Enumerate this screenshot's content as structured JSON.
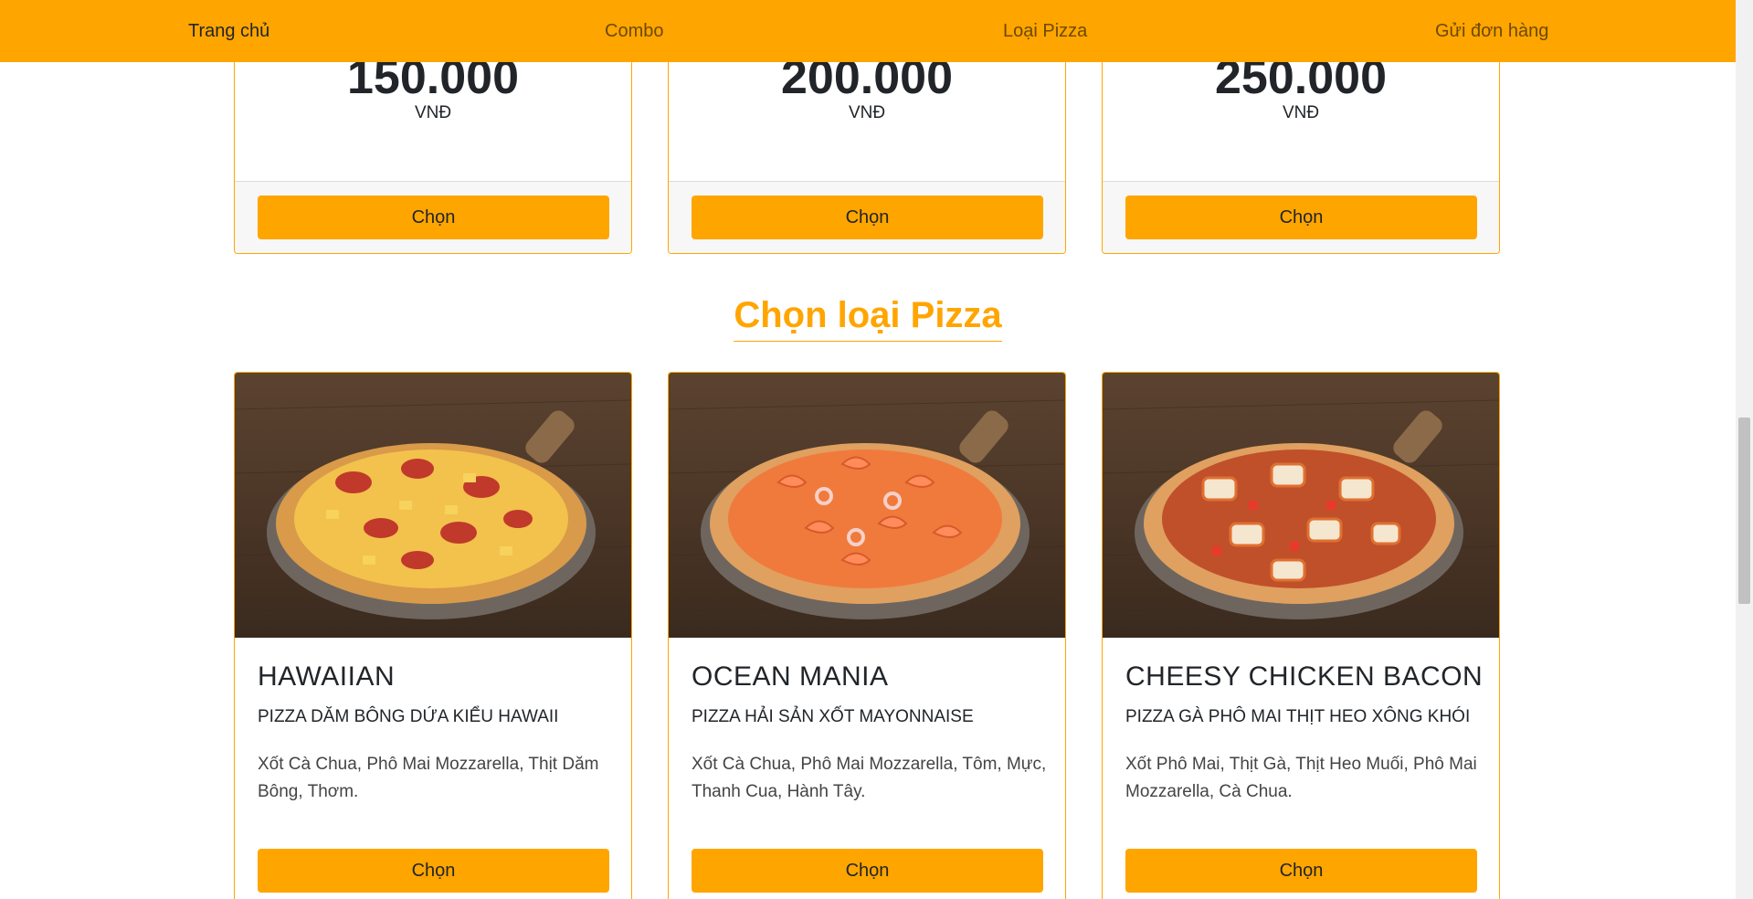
{
  "nav": {
    "items": [
      {
        "label": "Trang chủ",
        "active": true
      },
      {
        "label": "Combo",
        "active": false
      },
      {
        "label": "Loại Pizza",
        "active": false
      },
      {
        "label": "Gửi đơn hàng",
        "active": false
      }
    ]
  },
  "combos": [
    {
      "price": "150.000",
      "unit": "VNĐ",
      "button": "Chọn"
    },
    {
      "price": "200.000",
      "unit": "VNĐ",
      "button": "Chọn"
    },
    {
      "price": "250.000",
      "unit": "VNĐ",
      "button": "Chọn"
    }
  ],
  "pizza_section": {
    "title": "Chọn loại Pizza",
    "items": [
      {
        "name": "HAWAIIAN",
        "subtitle": "PIZZA DĂM BÔNG DỨA KIỂU HAWAII",
        "description": "Xốt Cà Chua, Phô Mai Mozzarella, Thịt Dăm Bông, Thơm.",
        "button": "Chọn",
        "image_icon": "pizza-hawaiian-image"
      },
      {
        "name": "OCEAN MANIA",
        "subtitle": "PIZZA HẢI SẢN XỐT MAYONNAISE",
        "description": "Xốt Cà Chua, Phô Mai Mozzarella, Tôm, Mực, Thanh Cua, Hành Tây.",
        "button": "Chọn",
        "image_icon": "pizza-ocean-mania-image"
      },
      {
        "name": "CHEESY CHICKEN BACON",
        "subtitle": "PIZZA GÀ PHÔ MAI THỊT HEO XÔNG KHÓI",
        "description": "Xốt Phô Mai, Thịt Gà, Thịt Heo Muối, Phô Mai Mozzarella, Cà Chua.",
        "button": "Chọn",
        "image_icon": "pizza-cheesy-chicken-bacon-image"
      }
    ]
  },
  "colors": {
    "accent": "#ffa500",
    "text": "#212529"
  }
}
